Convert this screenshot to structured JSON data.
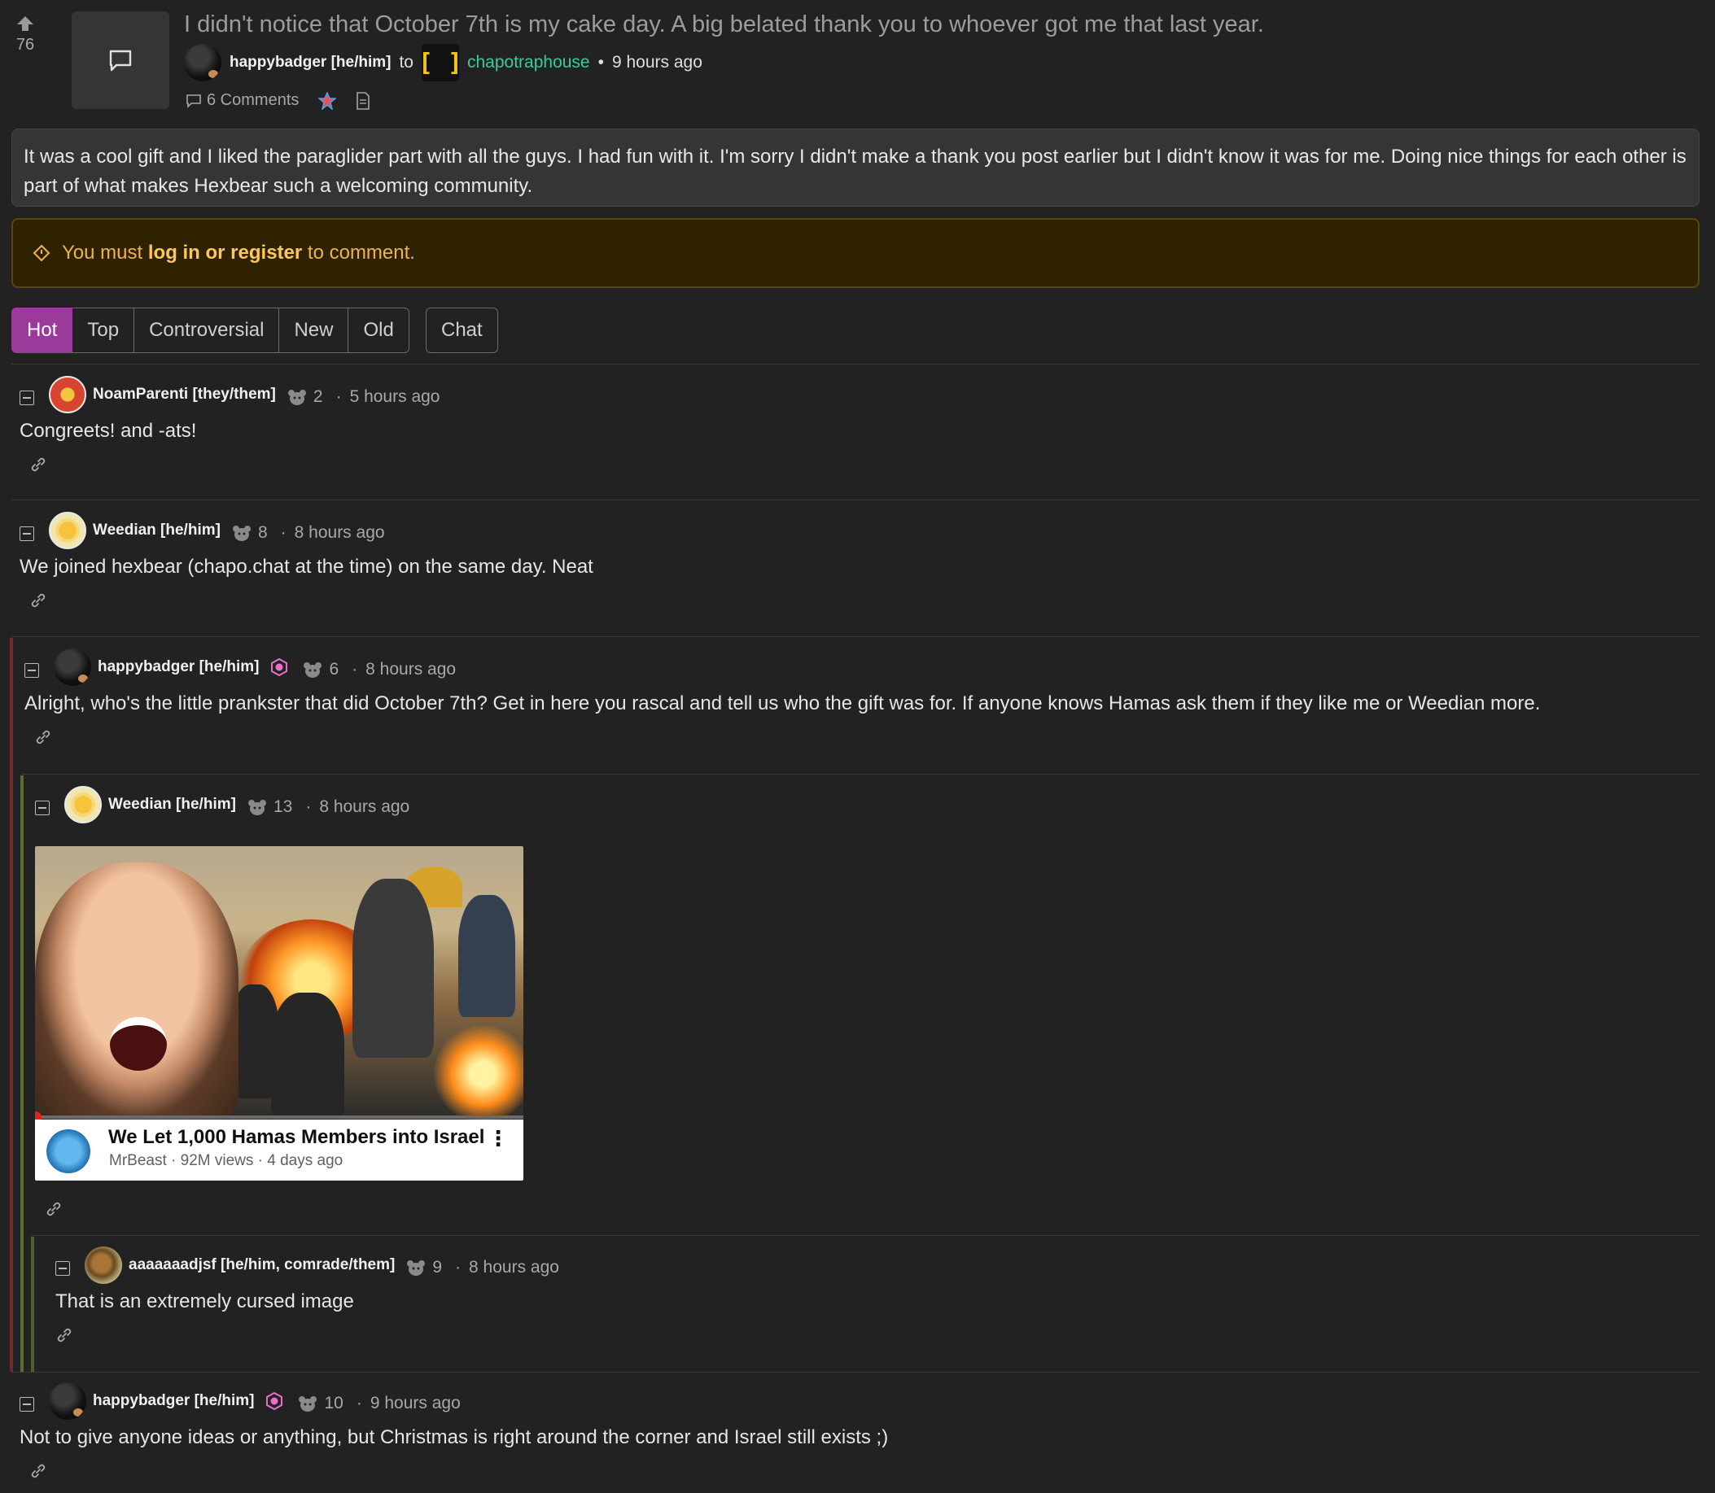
{
  "post": {
    "score": "76",
    "title": "I didn't notice that October 7th is my cake day. A big belated thank you to whoever got me that last year.",
    "author": "happybadger [he/him]",
    "to": "to",
    "community_icon": "[ ]",
    "community": "chapotraphouse",
    "sep": "•",
    "time": "9 hours ago",
    "comments": "6 Comments",
    "body": "It was a cool gift and I liked the paraglider part with all the guys. I had fun with it. I'm sorry I didn't make a thank you post earlier but I didn't know it was for me. Doing nice things for each other is part of what makes Hexbear such a welcoming community."
  },
  "login_notice": {
    "prefix": "You must",
    "link": "log in or register",
    "suffix": "to comment."
  },
  "sort_tabs": [
    {
      "label": "Hot",
      "active": true
    },
    {
      "label": "Top"
    },
    {
      "label": "Controversial"
    },
    {
      "label": "New"
    },
    {
      "label": "Old"
    }
  ],
  "chat_label": "Chat",
  "comments": [
    {
      "author": "NoamParenti [they/them]",
      "score": "2",
      "time": "5 hours ago",
      "text": "Congreets! and -ats!"
    },
    {
      "author": "Weedian [he/him]",
      "score": "8",
      "time": "8 hours ago",
      "text": "We joined hexbear (chapo.chat at the time) on the same day. Neat"
    },
    {
      "author": "happybadger [he/him]",
      "score": "6",
      "time": "8 hours ago",
      "text": "Alright, who's the little prankster that did October 7th? Get in here you rascal and tell us who the gift was for. If anyone knows Hamas ask them if they like me or Weedian more."
    },
    {
      "author": "Weedian [he/him]",
      "score": "13",
      "time": "8 hours ago",
      "embed": {
        "title": "We Let 1,000 Hamas Members into Israel",
        "meta": "MrBeast · 92M views · 4 days ago"
      }
    },
    {
      "author": "aaaaaaadjsf [he/him, comrade/them]",
      "score": "9",
      "time": "8 hours ago",
      "text": "That is an extremely cursed image"
    },
    {
      "author": "happybadger [he/him]",
      "score": "10",
      "time": "9 hours ago",
      "text": "Not to give anyone ideas or anything, but Christmas is right around the corner and Israel still exists ;)"
    }
  ],
  "meta_sep": "·",
  "colors": {
    "accent": "#9b3a9b",
    "community": "#3ec99a",
    "warning_text": "#f0b24a",
    "thread_red": "#6e2b2b",
    "thread_olive": "#5f6b2a"
  }
}
